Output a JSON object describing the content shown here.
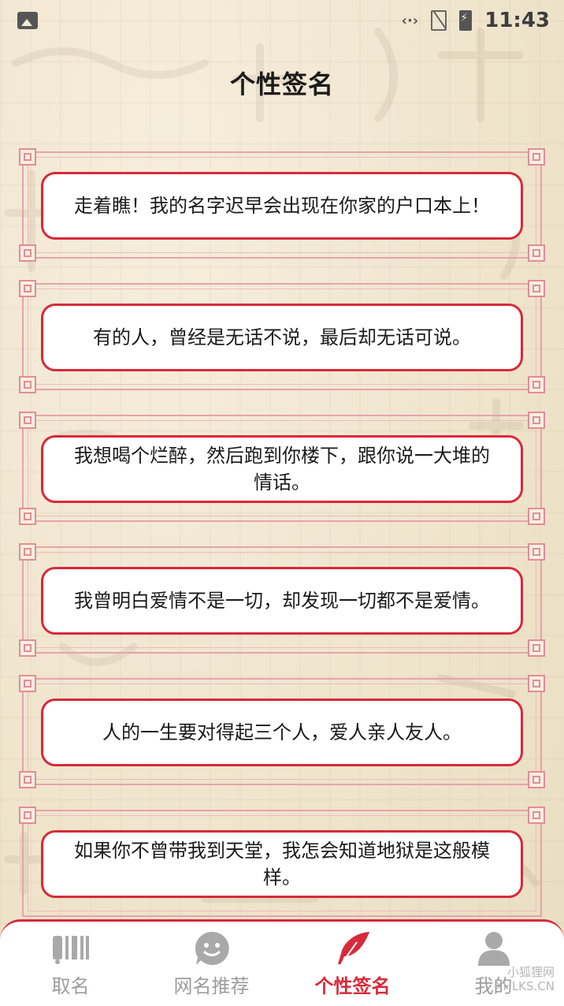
{
  "status_bar": {
    "time": "11:43"
  },
  "title": "个性签名",
  "signatures": [
    {
      "text": "走着瞧！我的名字迟早会出现在你家的户口本上！"
    },
    {
      "text": "有的人，曾经是无话不说，最后却无话可说。"
    },
    {
      "text": "我想喝个烂醉，然后跑到你楼下，跟你说一大堆的情话。"
    },
    {
      "text": "我曾明白爱情不是一切，却发现一切都不是爱情。"
    },
    {
      "text": "人的一生要对得起三个人，爱人亲人友人。"
    },
    {
      "text": "如果你不曾带我到天堂，我怎会知道地狱是这般模样。"
    }
  ],
  "nav": {
    "items": [
      {
        "label": "取名",
        "icon": "barcode-name-icon"
      },
      {
        "label": "网名推荐",
        "icon": "smiley-chat-icon"
      },
      {
        "label": "个性签名",
        "icon": "quill-feather-icon"
      },
      {
        "label": "我的",
        "icon": "user-profile-icon"
      }
    ],
    "active_index": 2
  },
  "watermark": {
    "line1": "小狐狸网",
    "line2": "XHLKS.CN"
  },
  "colors": {
    "accent": "#d82a3a",
    "background": "#f3ead6"
  }
}
